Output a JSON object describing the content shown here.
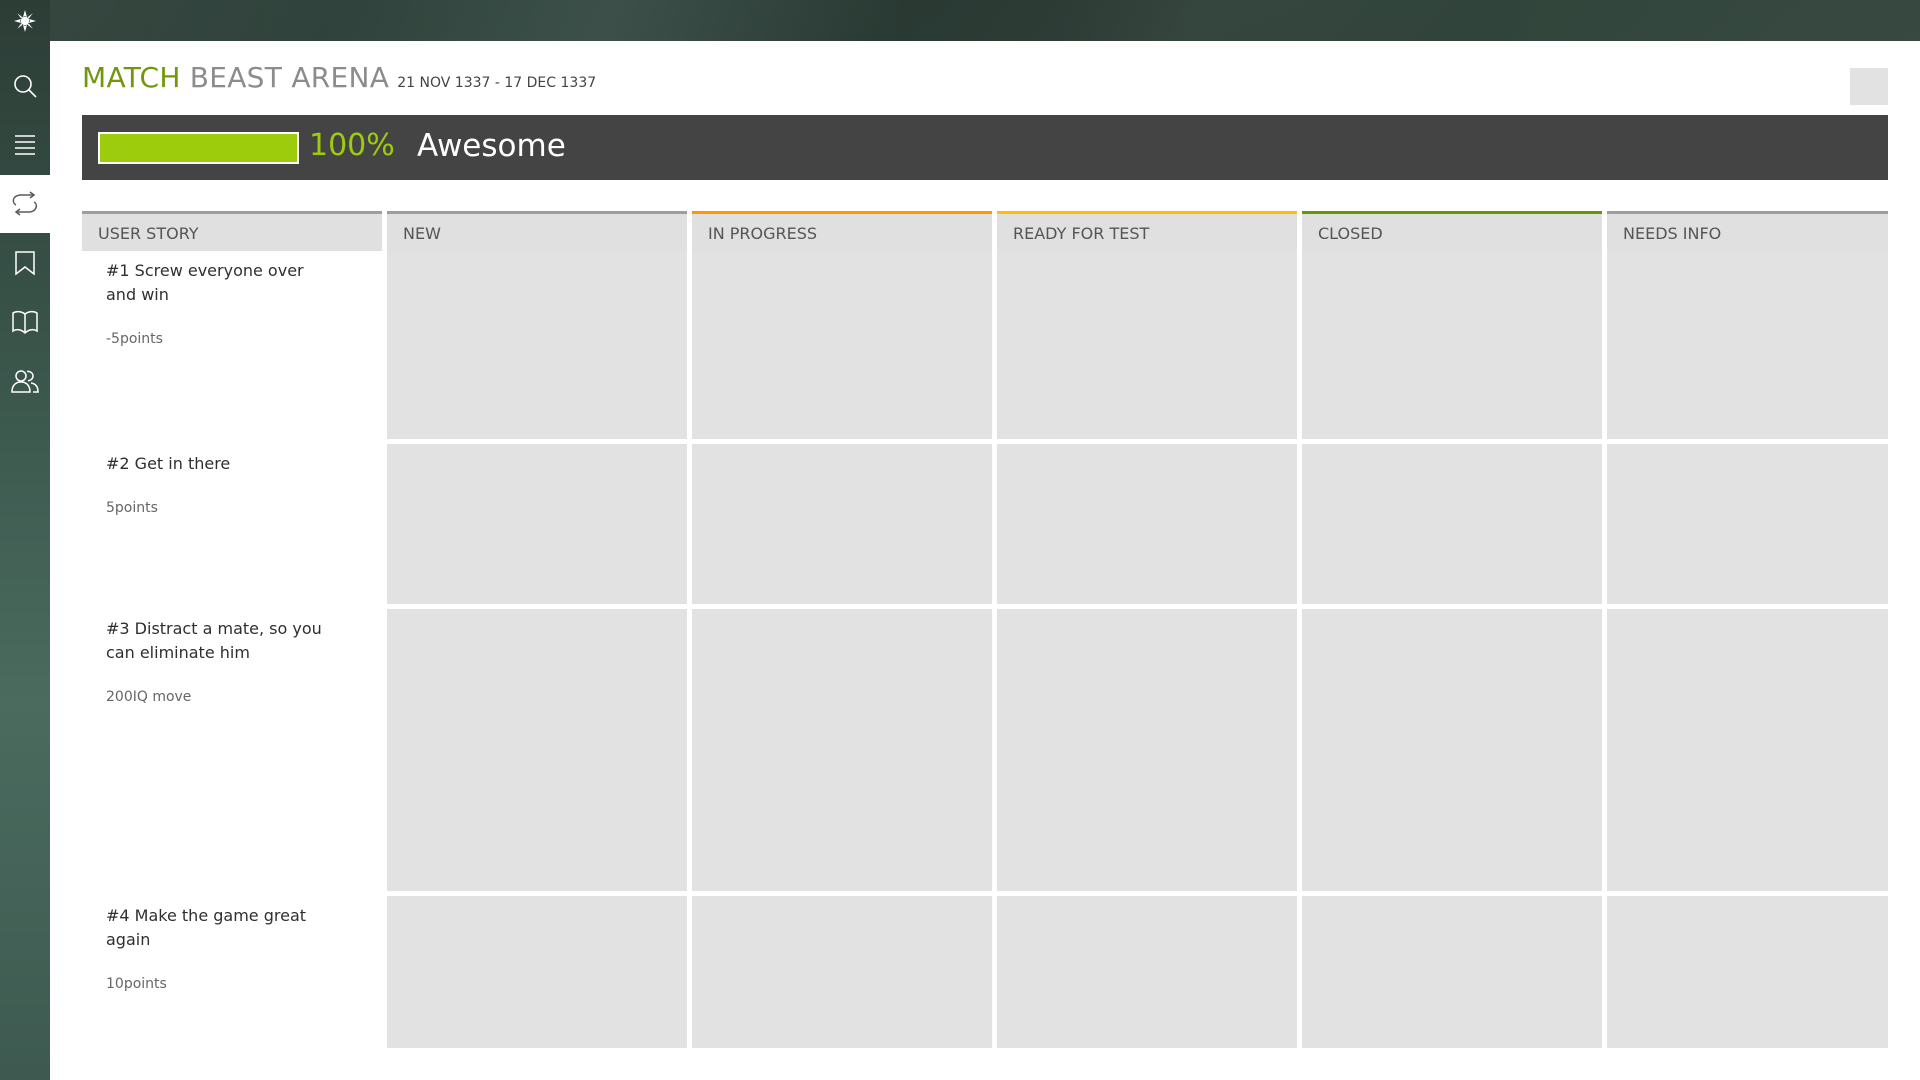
{
  "sidebar": {
    "logo_icon": "taiga-logo-icon",
    "items": [
      {
        "name": "search",
        "icon": "search-icon"
      },
      {
        "name": "backlog",
        "icon": "menu-icon"
      },
      {
        "name": "sprints",
        "icon": "cycle-icon"
      },
      {
        "name": "issues",
        "icon": "bookmark-icon"
      },
      {
        "name": "wiki",
        "icon": "book-icon"
      },
      {
        "name": "team",
        "icon": "team-icon"
      }
    ]
  },
  "header": {
    "project": "MATCH",
    "sprint": "BEAST ARENA",
    "dates": "21 NOV 1337 - 17 DEC 1337"
  },
  "summary": {
    "progress_percent": 100,
    "progress_text": "100%",
    "label": "Awesome",
    "progress_color": "#9dcc0c"
  },
  "board": {
    "story_header": "USER STORY",
    "columns": [
      {
        "label": "NEW",
        "color": "#9e9e9e"
      },
      {
        "label": "IN PROGRESS",
        "color": "#ff9900"
      },
      {
        "label": "READY FOR TEST",
        "color": "#fcc000"
      },
      {
        "label": "CLOSED",
        "color": "#669900"
      },
      {
        "label": "NEEDS INFO",
        "color": "#9e9e9e"
      }
    ],
    "stories": [
      {
        "title": "#1 Screw everyone over and win",
        "points": "-5points"
      },
      {
        "title": "#2 Get in there",
        "points": "5points"
      },
      {
        "title": "#3 Distract a mate, so you can eliminate him",
        "points": "200IQ move"
      },
      {
        "title": "#4 Make the game great again",
        "points": "10points"
      }
    ]
  }
}
